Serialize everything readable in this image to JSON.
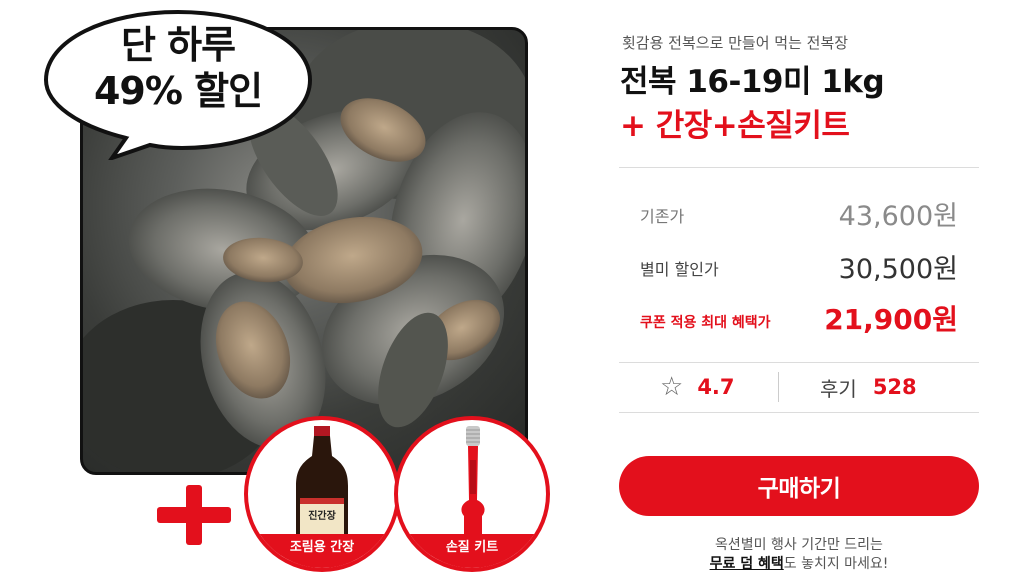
{
  "badge": {
    "line1": "단 하루",
    "line2": "49% 할인"
  },
  "addons": [
    {
      "label": "조림용 간장",
      "bottle_text": "진간장"
    },
    {
      "label": "손질 키트"
    }
  ],
  "product": {
    "subtitle": "횟감용 전복으로 만들어 먹는 전복장",
    "title_line1": "전복 16-19미 1kg",
    "title_line2": "+ 간장+손질키트"
  },
  "prices": {
    "original": {
      "label": "기존가",
      "value": "43,600원"
    },
    "member": {
      "label": "별미 할인가",
      "value": "30,500원"
    },
    "coupon": {
      "label": "쿠폰 적용 최대 혜택가",
      "value": "21,900원"
    }
  },
  "rating": {
    "icon": "star-outline-icon",
    "star_glyph": "☆",
    "value": "4.7"
  },
  "reviews": {
    "label": "후기",
    "count": "528"
  },
  "buy_button": {
    "label": "구매하기"
  },
  "notice": {
    "line1": "옥션별미 행사 기간만 드리는",
    "line2_strong": "무료 덤 혜택",
    "line2_rest": "도 놓치지 마세요!"
  },
  "colors": {
    "accent": "#e3101c",
    "text": "#222222",
    "muted": "#8a8a8a"
  }
}
